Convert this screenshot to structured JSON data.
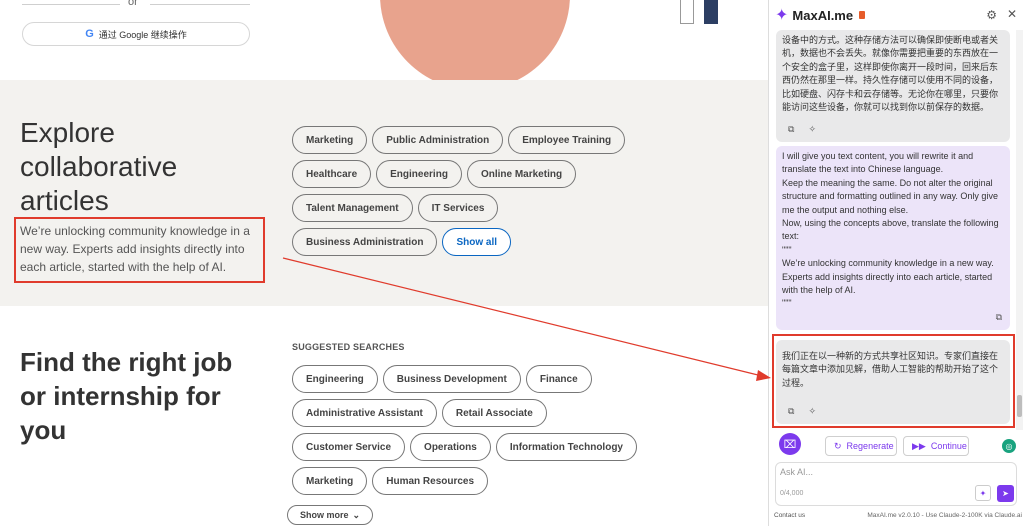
{
  "auth": {
    "or_text": "or",
    "google_button": "通过 Google 继续操作",
    "google_icon": "google-icon"
  },
  "explore": {
    "title": "Explore collaborative articles",
    "subtitle": "We’re unlocking community knowledge in a new way. Experts add insights directly into each article, started with the help of AI.",
    "topics": [
      "Marketing",
      "Public Administration",
      "Employee Training",
      "Healthcare",
      "Engineering",
      "Online Marketing",
      "Talent Management",
      "IT Services",
      "Business Administration"
    ],
    "show_all": "Show all"
  },
  "jobs": {
    "title": "Find the right job or internship for you",
    "suggested_heading": "SUGGESTED SEARCHES",
    "searches": [
      "Engineering",
      "Business Development",
      "Finance",
      "Administrative Assistant",
      "Retail Associate",
      "Customer Service",
      "Operations",
      "Information Technology",
      "Marketing",
      "Human Resources"
    ],
    "show_more": "Show more"
  },
  "sidebar": {
    "brand": "MaxAI.me",
    "logo_icon": "sparkle-icon",
    "messages": [
      {
        "role": "ai",
        "text": "设备中的方式。这种存储方法可以确保即使断电或者关机，数据也不会丢失。就像你需要把重要的东西放在一个安全的盒子里，这样即使你离开一段时间，回来后东西仍然在那里一样。持久性存储可以使用不同的设备，比如硬盘、闪存卡和云存储等。无论你在哪里，只要你能访问这些设备，你就可以找到你以前保存的数据。"
      },
      {
        "role": "user",
        "text": "I will give you text content, you will rewrite it and translate the text into Chinese language.\nKeep the meaning the same. Do not alter the original structure and formatting outlined in any way. Only give me the output and nothing else.\nNow, using the concepts above, translate the following text:\n\"\"\"\nWe’re unlocking community knowledge in a new way. Experts add insights directly into each article, started with the help of AI.\n\"\"\""
      },
      {
        "role": "ai",
        "text": "我们正在以一种新的方式共享社区知识。专家们直接在每篇文章中添加见解，借助人工智能的帮助开始了这个过程。"
      }
    ],
    "regenerate": "Regenerate",
    "continue": "Continue",
    "input_placeholder": "Ask AI...",
    "char_count": "0/4,000",
    "footer_left": "Contact us",
    "footer_right": "MaxAI.me v2.0.10 - Use Claude-2-100K via Claude.ai"
  },
  "colors": {
    "accent": "#7c3aed",
    "highlight_box": "#e03b2c",
    "link_blue": "#0a66c2",
    "explore_bg": "#f3f2ef"
  }
}
